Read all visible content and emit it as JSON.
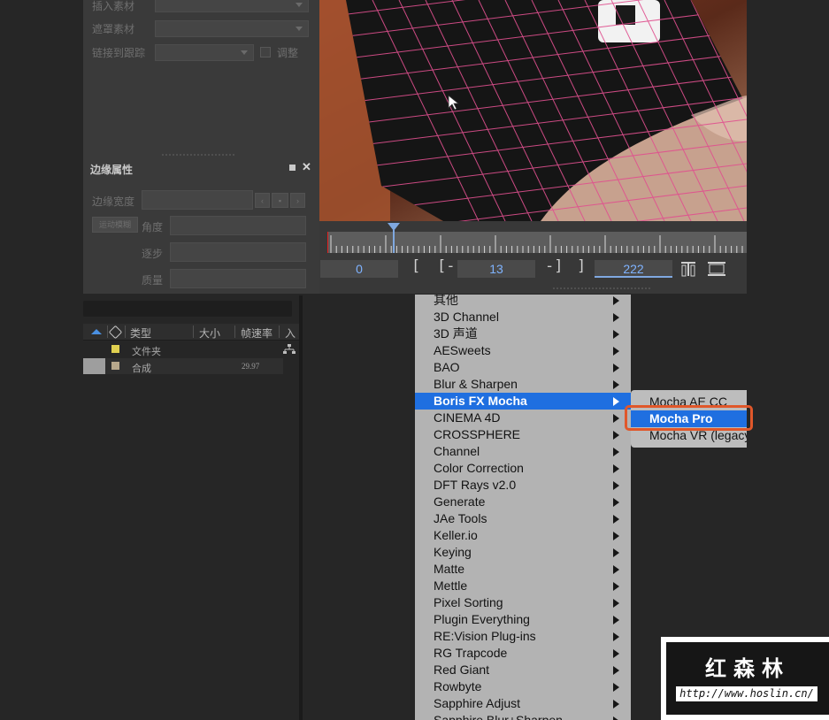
{
  "mocha_panel": {
    "insert_label": "插入素材",
    "matte_label": "遮罩素材",
    "link_label": "链接到跟踪",
    "adjust_label": "调整",
    "edge_section_title": "边缘属性",
    "edge_width_label": "边缘宽度",
    "angle_label": "角度",
    "steps_label": "逐步",
    "quality_label": "质量",
    "motion_blur_label": "运动模糊"
  },
  "timeline": {
    "in_frame": "0",
    "current_frame": "13",
    "out_frame": "222",
    "bracket_open": "[",
    "bracket_in": "[-",
    "bracket_out": "-]",
    "bracket_close": "]"
  },
  "project": {
    "columns": [
      "类型",
      "大小",
      "帧速率",
      "入"
    ],
    "rows": [
      {
        "type": "文件夹",
        "framerate": "",
        "color": "#e0d050"
      },
      {
        "type": "合成",
        "framerate": "29.97",
        "color": "#b8a88c"
      }
    ]
  },
  "effect_menu": {
    "items": [
      "其他",
      "3D Channel",
      "3D 声道",
      "AESweets",
      "BAO",
      "Blur & Sharpen",
      "Boris FX Mocha",
      "CINEMA 4D",
      "CROSSPHERE",
      "Channel",
      "Color Correction",
      "DFT Rays v2.0",
      "Generate",
      "JAe Tools",
      "Keller.io",
      "Keying",
      "Matte",
      "Mettle",
      "Pixel Sorting",
      "Plugin Everything",
      "RE:Vision Plug-ins",
      "RG Trapcode",
      "Red Giant",
      "Rowbyte",
      "Sapphire Adjust",
      "Sapphire Blur+Sharpen"
    ],
    "selected_index": 6
  },
  "submenu": {
    "items": [
      "Mocha AE CC",
      "Mocha Pro",
      "Mocha VR (legacy)"
    ],
    "selected_index": 1
  },
  "watermark": {
    "title": "红森林",
    "url": "http://www.hoslin.cn/"
  },
  "colors": {
    "menu_highlight": "#1f6fe0",
    "callout_outline": "#e0572a",
    "frame_text": "#7fb3ff"
  }
}
